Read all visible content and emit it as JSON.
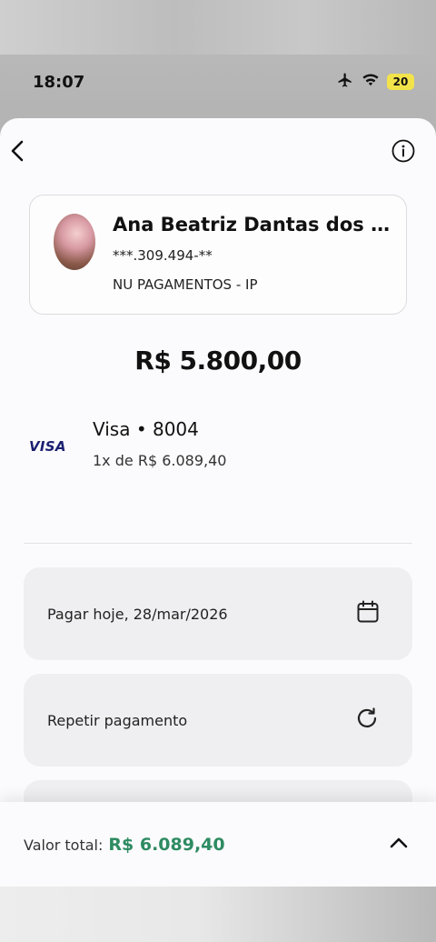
{
  "status_bar": {
    "time": "18:07",
    "battery_level": "20"
  },
  "icons": {
    "back": "chevron-left-icon",
    "info": "info-circle-icon",
    "calendar": "calendar-icon",
    "repeat": "refresh-icon",
    "expand": "chevron-up-icon"
  },
  "recipient": {
    "name": "Ana Beatriz Dantas dos Sant...",
    "document": "***.309.494-**",
    "bank": "NU PAGAMENTOS - IP"
  },
  "payment": {
    "amount": "R$ 5.800,00",
    "card_brand_logo": "VISA",
    "card_title": "Visa • 8004",
    "installments": "1x de R$ 6.089,40"
  },
  "options": [
    {
      "label": "Pagar hoje, 28/mar/2026"
    },
    {
      "label": "Repetir pagamento"
    }
  ],
  "footer": {
    "total_label": "Valor total:",
    "total_value": "R$ 6.089,40"
  },
  "colors": {
    "accent_green": "#2e8b62",
    "visa_blue": "#1a1f71"
  }
}
